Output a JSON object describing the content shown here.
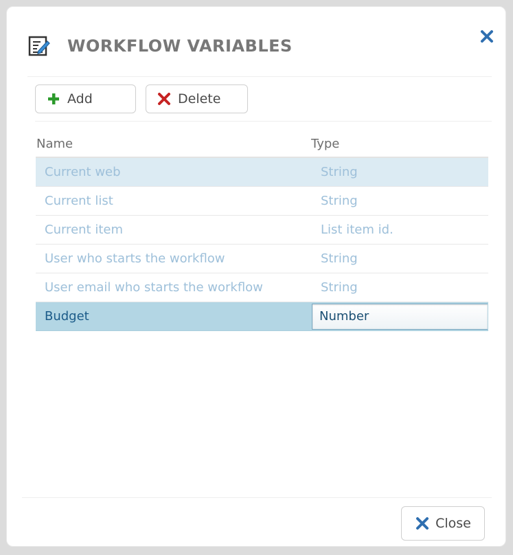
{
  "dialog": {
    "title": "WORKFLOW VARIABLES",
    "title_icon": "edit-document-icon",
    "close_icon": "close-icon"
  },
  "toolbar": {
    "add_label": "Add",
    "add_icon": "plus-icon",
    "delete_label": "Delete",
    "delete_icon": "delete-x-icon"
  },
  "grid": {
    "columns": [
      "Name",
      "Type"
    ],
    "rows": [
      {
        "name": "Current web",
        "type": "String"
      },
      {
        "name": "Current list",
        "type": "String"
      },
      {
        "name": "Current item",
        "type": "List item id."
      },
      {
        "name": "User who starts the workflow",
        "type": "String"
      },
      {
        "name": "User email who starts the workflow",
        "type": "String"
      },
      {
        "name": "Budget",
        "type": "Number"
      }
    ],
    "hovered_row": 0,
    "selected_row": 5
  },
  "footer": {
    "close_label": "Close",
    "close_icon": "close-x-icon"
  },
  "colors": {
    "title_gray": "#777777",
    "accent_blue": "#2f6fb0",
    "add_green": "#2c9a2c",
    "delete_red": "#c62323",
    "row_hover": "#dcebf3",
    "row_selected": "#b3d6e4"
  }
}
